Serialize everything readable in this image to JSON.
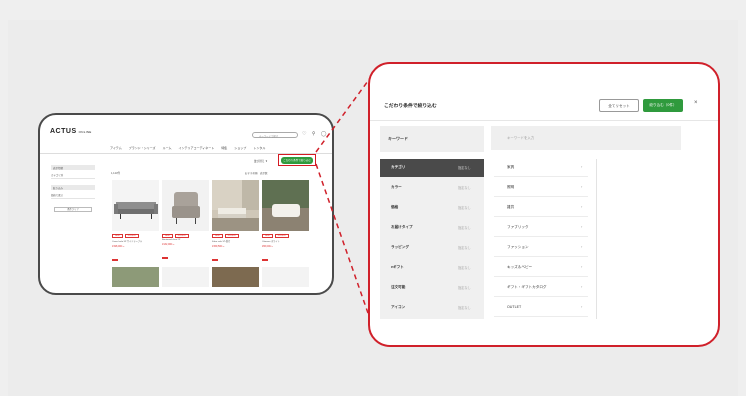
{
  "mini_page": {
    "logo": "ACTUS",
    "logo_sub": "ONLINE",
    "search_placeholder": "キーワードで探す",
    "header_icons": "♡ ⚲ ◯",
    "nav": [
      "アイテム",
      "ブランド・シリーズ",
      "ルーム",
      "インテリアコーディネート",
      "特集",
      "ショップ",
      "レンタル"
    ],
    "filter_link": "並び替え ▼",
    "filter_button": "こだわり条件で絞り込む",
    "side_head_1": "表示切替",
    "side_item_1": "カテゴリ別",
    "side_head_2": "絞り込み",
    "side_item_2": "価格で選ぶ",
    "side_button": "条件クリア",
    "result_count": "1,123件",
    "sort_label": "おすすめ順　表示数",
    "cards": [
      {
        "tag1": "NEW",
        "tag2": "送料無料",
        "name": "Camel sofa 3P サイドテーブル",
        "price": "¥198,000〜"
      },
      {
        "tag1": "NEW",
        "tag2": "送料無料",
        "name": "Bentwood chair 2P",
        "price": "¥132,000〜"
      },
      {
        "tag1": "NEW",
        "tag2": "送料無料",
        "name": "Kaba sofa 3人掛け",
        "price": "¥159,500〜"
      },
      {
        "tag1": "NEW",
        "tag2": "送料無料",
        "name": "Ottoman ホワイト",
        "price": "¥66,000〜"
      }
    ]
  },
  "filter_panel": {
    "title": "こだわり条件で絞り込む",
    "reset_button": "全てリセット",
    "apply_button": "絞り込む（0件）",
    "close_icon": "×",
    "keyword_label": "キーワード",
    "keyword_placeholder": "キーワードを入力",
    "categories": [
      {
        "label": "カテゴリ",
        "sub": "指定なし",
        "active": true
      },
      {
        "label": "カラー",
        "sub": "指定なし",
        "active": false
      },
      {
        "label": "価格",
        "sub": "指定なし",
        "active": false
      },
      {
        "label": "お届けタイプ",
        "sub": "指定なし",
        "active": false
      },
      {
        "label": "ラッピング",
        "sub": "指定なし",
        "active": false
      },
      {
        "label": "eギフト",
        "sub": "指定なし",
        "active": false
      },
      {
        "label": "注文可能",
        "sub": "指定なし",
        "active": false
      },
      {
        "label": "アイコン",
        "sub": "指定なし",
        "active": false
      }
    ],
    "options": [
      {
        "label": "家具"
      },
      {
        "label": "照明"
      },
      {
        "label": "雑貨"
      },
      {
        "label": "ファブリック"
      },
      {
        "label": "ファッション"
      },
      {
        "label": "キッズ＆ベビー"
      },
      {
        "label": "ギフト・ギフトカタログ"
      },
      {
        "label": "OUTLET"
      }
    ]
  },
  "colors": {
    "accent_green": "#2f9a3d",
    "highlight_red": "#d0202a",
    "active_category": "#4a4a4a"
  }
}
